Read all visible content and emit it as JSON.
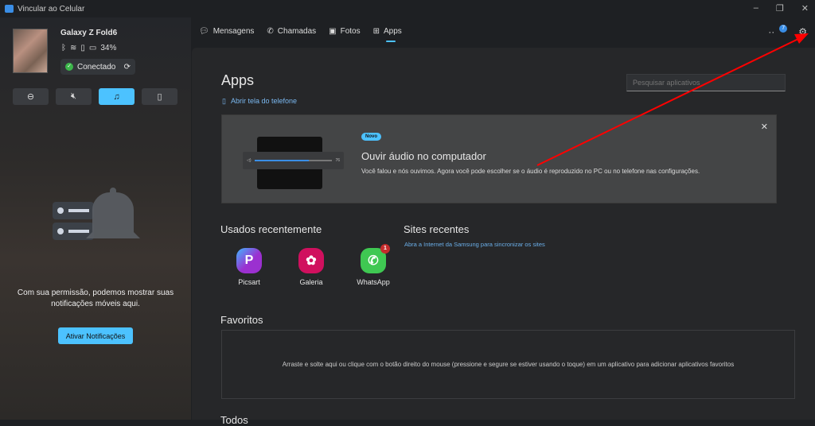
{
  "window": {
    "title": "Vincular ao Celular",
    "minimize": "–",
    "maximize": "❐",
    "close": "✕"
  },
  "device": {
    "name": "Galaxy Z Fold6",
    "battery": "34%",
    "status": "Conectado"
  },
  "notifications": {
    "message": "Com sua permissão, podemos mostrar suas notificações móveis aqui.",
    "button": "Ativar Notificações"
  },
  "tabs": [
    {
      "label": "Mensagens"
    },
    {
      "label": "Chamadas"
    },
    {
      "label": "Fotos"
    },
    {
      "label": "Apps",
      "active": true
    }
  ],
  "header": {
    "badge": "7"
  },
  "apps_page": {
    "title": "Apps",
    "search_placeholder": "Pesquisar aplicativos",
    "open_phone": "Abrir tela do telefone"
  },
  "banner": {
    "badge": "Novo",
    "title": "Ouvir áudio no computador",
    "description": "Você falou e nós ouvimos. Agora você pode escolher se o áudio é reproduzido no PC ou no telefone nas configurações.",
    "slider_value": "76"
  },
  "recent": {
    "title": "Usados recentemente",
    "apps": [
      {
        "name": "Picsart",
        "color": "#8e3ad6"
      },
      {
        "name": "Galeria",
        "color": "#d0105e"
      },
      {
        "name": "WhatsApp",
        "color": "#3fc852",
        "badge": "1"
      }
    ]
  },
  "sites": {
    "title": "Sites recentes",
    "link": "Abra a Internet da Samsung para sincronizar os sites"
  },
  "favorites": {
    "title": "Favoritos",
    "hint": "Arraste e solte aqui ou clique com o botão direito do mouse (pressione e segure se estiver usando o toque) em um aplicativo para adicionar aplicativos favoritos"
  },
  "all_apps": {
    "title": "Todos"
  },
  "colors": {
    "accent": "#4cc2ff",
    "annotation_arrow": "#ff0000"
  }
}
